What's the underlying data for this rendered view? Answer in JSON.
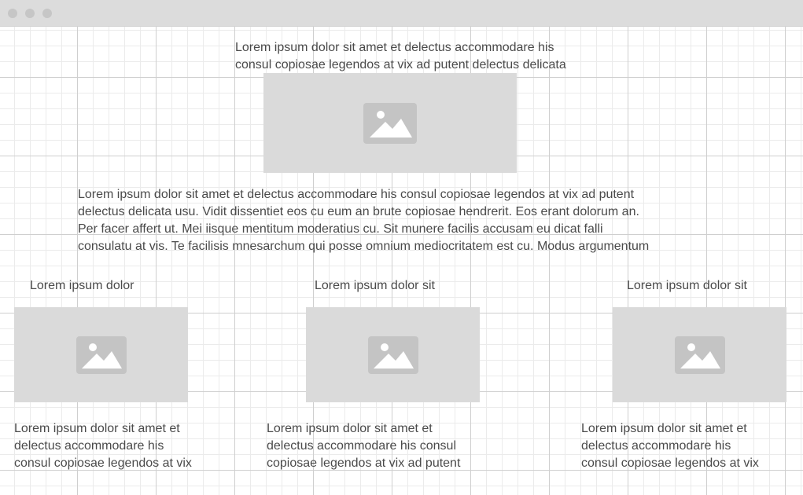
{
  "window": {
    "controls": [
      "close-dot",
      "minimize-dot",
      "maximize-dot"
    ]
  },
  "header_text": {
    "lines": [
      "Lorem ipsum dolor sit amet et delectus accommodare his",
      "consul copiosae legendos at vix ad putent delectus delicata"
    ]
  },
  "hero_image": {
    "icon": "image-placeholder-icon"
  },
  "body_text": {
    "lines": [
      "Lorem ipsum dolor sit amet et delectus accommodare his consul copiosae legendos at vix ad putent",
      "delectus delicata usu. Vidit dissentiet eos cu eum an brute copiosae hendrerit. Eos erant dolorum an.",
      "Per facer affert ut. Mei iisque mentitum moderatius cu. Sit munere facilis accusam eu dicat falli",
      "consulatu at vis. Te facilisis mnesarchum qui posse omnium mediocritatem est cu. Modus argumentum"
    ]
  },
  "cards": [
    {
      "title": "Lorem ipsum dolor",
      "image_icon": "image-placeholder-icon",
      "lines": [
        "Lorem ipsum dolor sit amet et",
        "delectus accommodare his",
        "consul copiosae legendos at vix"
      ]
    },
    {
      "title": "Lorem ipsum dolor sit",
      "image_icon": "image-placeholder-icon",
      "lines": [
        "Lorem ipsum dolor sit amet et",
        "delectus accommodare his consul",
        "copiosae legendos at vix ad putent"
      ]
    },
    {
      "title": "Lorem ipsum dolor sit",
      "image_icon": "image-placeholder-icon",
      "lines": [
        "Lorem ipsum dolor sit amet et",
        "delectus accommodare his",
        "consul copiosae legendos at vix"
      ]
    }
  ],
  "colors": {
    "titlebar": "#dcdcdc",
    "placeholder_fill": "#dadada",
    "placeholder_icon": "#c4c4c4",
    "text": "#4a4a4a"
  }
}
